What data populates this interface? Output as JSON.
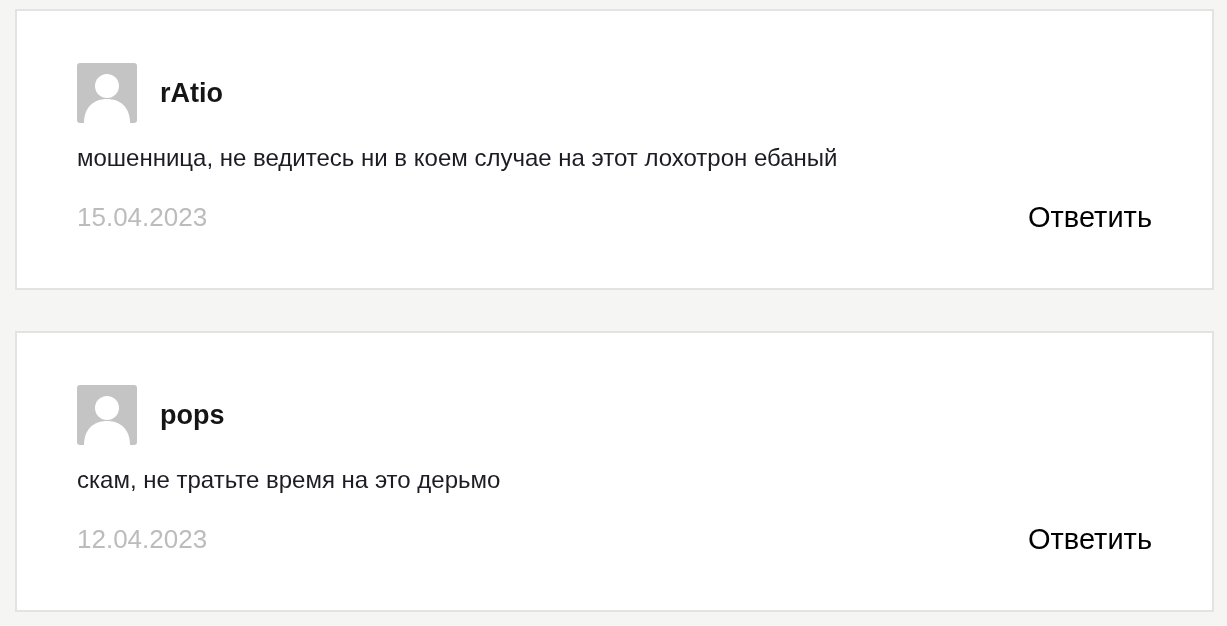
{
  "comments": [
    {
      "author": "rAtio",
      "text": "мошенница, не ведитесь ни в коем случае на этот лохотрон ебаный",
      "date": "15.04.2023",
      "reply": "Ответить"
    },
    {
      "author": "pops",
      "text": "скам, не тратьте время на это дерьмо",
      "date": "12.04.2023",
      "reply": "Ответить"
    }
  ]
}
